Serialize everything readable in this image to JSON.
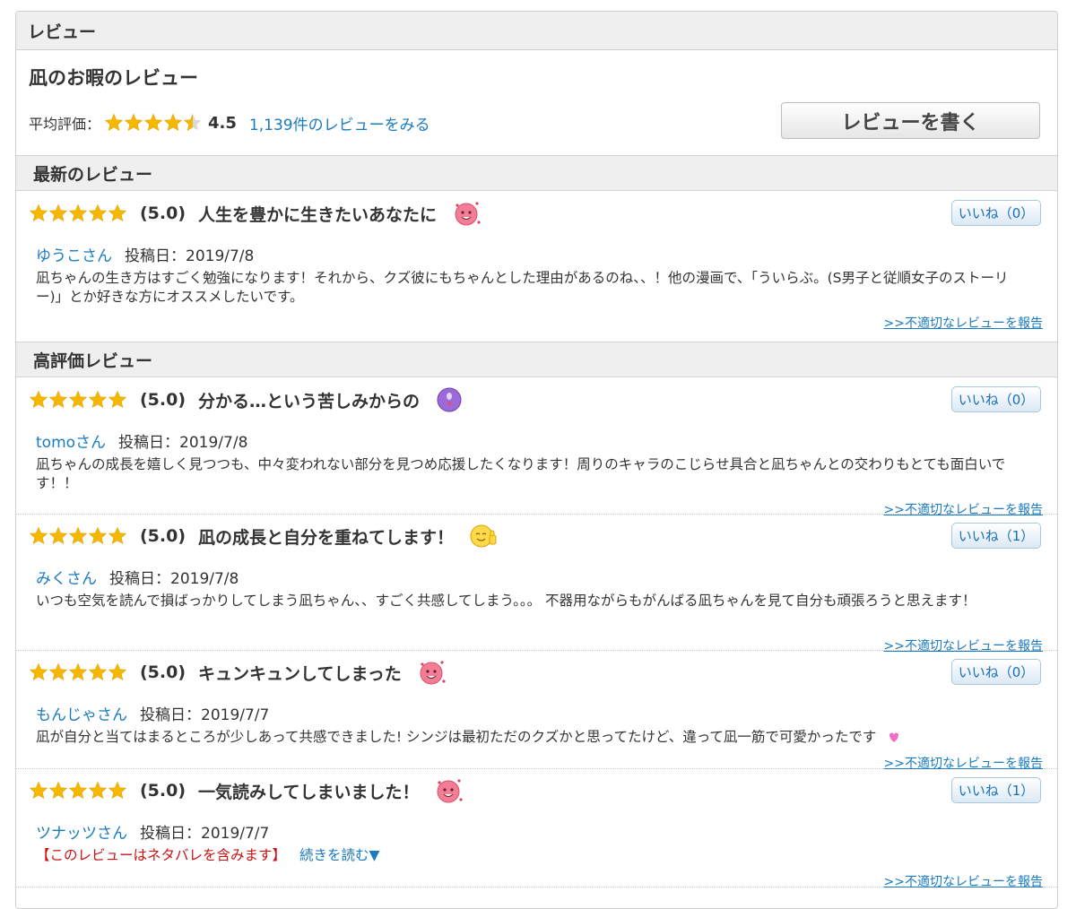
{
  "panel": {
    "title": "レビュー"
  },
  "work": {
    "title": "凪のお暇のレビュー",
    "avg_label": "平均評価：",
    "avg_score": "4.5",
    "avg_rating": 4.5,
    "all_reviews_link": "1,139件のレビューをみる",
    "write_button": "レビューを書く"
  },
  "sections": {
    "latest": "最新のレビュー",
    "top": "高評価レビュー"
  },
  "colors": {
    "star": "#f5b800",
    "link": "#1a7bbf",
    "spoiler": "#cc1111"
  },
  "reviews": [
    {
      "rating": 5,
      "score": "(5.0)",
      "title": "人生を豊かに生きたいあなたに",
      "emoji": "pink-heart-face-icon",
      "likes": "いいね（0）",
      "user": "ゆうこさん",
      "date": "投稿日：2019/7/8",
      "body": "凪ちゃんの生き方はすごく勉強になります！それから、クズ彼にもちゃんとした理由があるのね、、！他の漫画で、「ういらぶ。(S男子と従順女子のストーリー)」とか好きな方にオススメしたいです。",
      "report": ">>不適切なレビューを報告"
    },
    {
      "rating": 5,
      "score": "(5.0)",
      "title": "分かる…という苦しみからの",
      "emoji": "purple-face-icon",
      "likes": "いいね（0）",
      "user": "tomoさん",
      "date": "投稿日：2019/7/8",
      "body": "凪ちゃんの成長を嬉しく見つつも、中々変われない部分を見つめ応援したくなります！周りのキャラのこじらせ具合と凪ちゃんとの交わりもとても面白いです！！",
      "report": ">>不適切なレビューを報告"
    },
    {
      "rating": 5,
      "score": "(5.0)",
      "title": "凪の成長と自分を重ねてします！",
      "emoji": "thumbs-up-face-icon",
      "likes": "いいね（1）",
      "user": "みくさん",
      "date": "投稿日：2019/7/8",
      "body": "いつも空気を読んで損ばっかりしてしまう凪ちゃん、、すごく共感してしまう。。。 不器用ながらもがんばる凪ちゃんを見て自分も頑張ろうと思えます！",
      "report": ">>不適切なレビューを報告"
    },
    {
      "rating": 5,
      "score": "(5.0)",
      "title": "キュンキュンしてしまった",
      "emoji": "pink-heart-face-icon",
      "likes": "いいね（0）",
      "user": "もんじゃさん",
      "date": "投稿日：2019/7/7",
      "body": "凪が自分と当てはまるところが少しあって共感できました! シンジは最初ただのクズかと思ってたけど、違って凪一筋で可愛かったです",
      "report": ">>不適切なレビューを報告"
    },
    {
      "rating": 5,
      "score": "(5.0)",
      "title": "一気読みしてしまいました！",
      "emoji": "pink-heart-face-icon",
      "likes": "いいね（1）",
      "user": "ツナッツさん",
      "date": "投稿日：2019/7/7",
      "spoiler": "【このレビューはネタバレを含みます】",
      "read_more": "続きを読む▼",
      "report": ">>不適切なレビューを報告"
    }
  ]
}
